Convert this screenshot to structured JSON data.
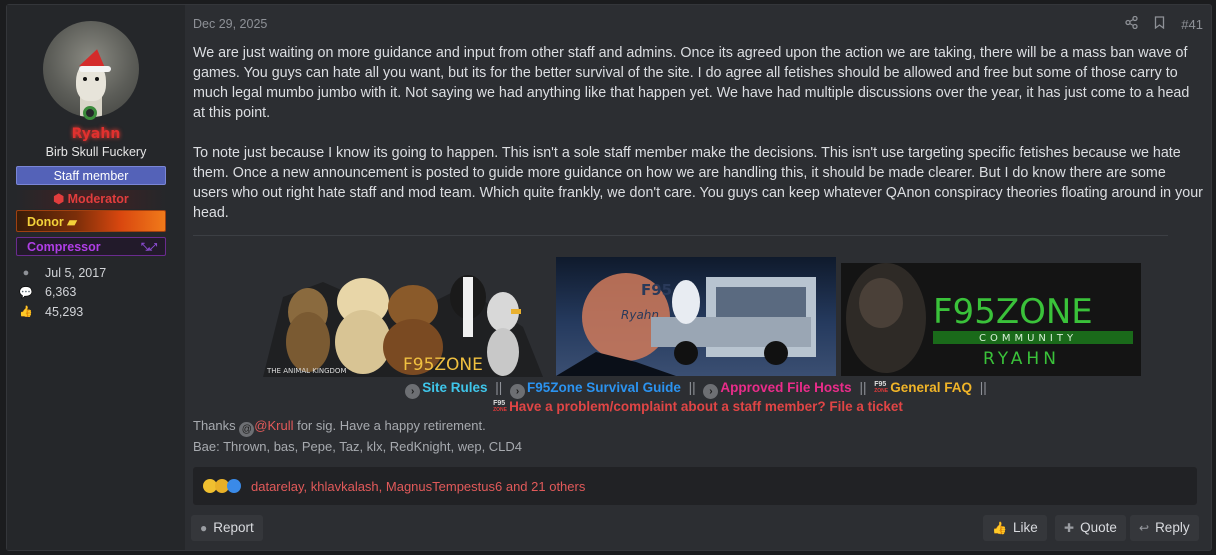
{
  "post": {
    "date": "Dec 29, 2025",
    "number": "#41",
    "paragraphs": [
      "We are just waiting on more guidance and input from other staff and admins. Once its agreed upon the action we are taking, there will be a mass ban wave of games. You guys can hate all you want, but its for the better survival of the site. I do agree all fetishes should be allowed and free but some of those carry to much legal mumbo jumbo with it. Not saying we had anything like that happen yet. We have had multiple discussions over the year, it has just come to a head at this point.",
      "To note just because I know its going to happen. This isn't a sole staff member make the decisions. This isn't use targeting specific fetishes because we hate them. Once a new announcement is posted to guide more guidance on how we are handling this, it should be made clearer. But I do know there are some users who out right hate staff and mod team. Which quite frankly, we don't care. You guys can keep whatever QAnon conspiracy theories floating around in your head."
    ]
  },
  "user": {
    "name": "Ryahn",
    "title": "Birb Skull Fuckery",
    "banners": {
      "staff": "Staff member",
      "moderator": "Moderator",
      "donor": "Donor",
      "compressor": "Compressor"
    },
    "joined": "Jul 5, 2017",
    "messages": "6,363",
    "reactions": "45,293"
  },
  "signature": {
    "img1_caption": "THE ANIMAL KINGDOM",
    "img1_logo": "F95ZONE",
    "img2_logo": "F95",
    "img2_sub": "Ryahn",
    "img3_logo": "F95ZONE",
    "img3_community": "COMMUNITY",
    "img3_name": "RYAHN",
    "links": {
      "rules": "Site Rules",
      "guide": "F95Zone Survival Guide",
      "hosts": "Approved File Hosts",
      "faq": "General FAQ",
      "ticket": "Have a problem/complaint about a staff member? File a ticket",
      "divider": "||"
    },
    "thanks_prefix": "Thanks",
    "thanks_mention": "@Krull",
    "thanks_suffix": "for sig. Have a happy retirement.",
    "bae_line": "Bae: Thrown, bas, Pepe, Taz, klx, RedKnight, wep, CLD4"
  },
  "reactions": {
    "names": "datarelay, khlavkalash, MagnusTempestus6 and 21 others"
  },
  "actions": {
    "report": "Report",
    "like": "Like",
    "quote": "Quote",
    "reply": "Reply"
  },
  "colors": {
    "background": "#2c2e32",
    "username": "#e0312f",
    "staff_banner": "#5462b8",
    "mention": "#e25a5a"
  }
}
